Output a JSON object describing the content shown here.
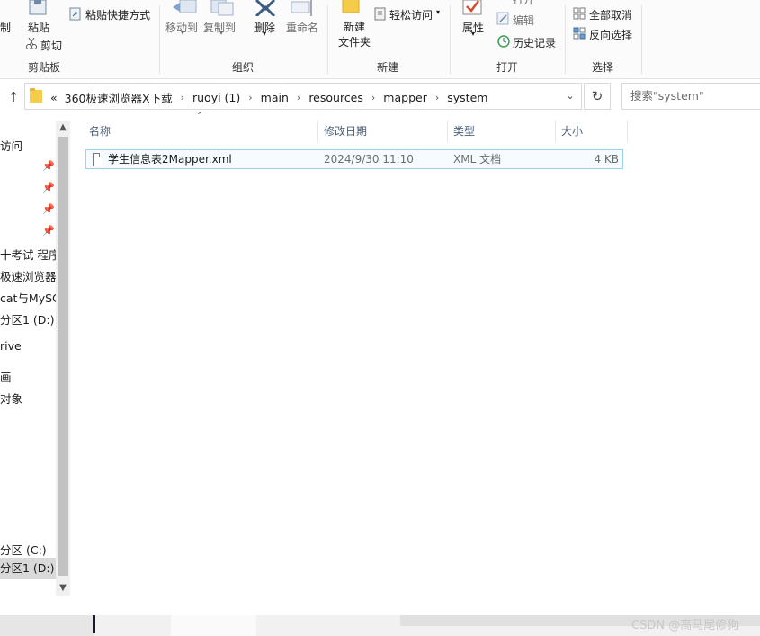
{
  "ribbon": {
    "clipboard": {
      "copy_label": "复制",
      "paste_label": "粘贴",
      "paste_shortcut_label": "粘贴快捷方式",
      "cut_label": "剪切",
      "group_label": "剪贴板"
    },
    "organize": {
      "move_to_label": "移动到",
      "copy_to_label": "复制到",
      "delete_label": "删除",
      "rename_label": "重命名",
      "group_label": "组织"
    },
    "new": {
      "new_folder_label": "新建\n文件夹",
      "easy_access_label": "轻松访问",
      "group_label": "新建"
    },
    "open": {
      "properties_label": "属性",
      "open_label": "打开",
      "edit_label": "编辑",
      "history_label": "历史记录",
      "group_label": "打开"
    },
    "select": {
      "select_all_label": "全部取消",
      "invert_label": "反向选择",
      "group_label": "选择"
    }
  },
  "address": {
    "overflow": "«",
    "crumbs": [
      "360极速浏览器X下载",
      "ruoyi (1)",
      "main",
      "resources",
      "mapper",
      "system"
    ],
    "search_placeholder": "搜索\"system\""
  },
  "nav": {
    "items": [
      {
        "label": "访问",
        "pinned": false
      },
      {
        "label": "",
        "pinned": true
      },
      {
        "label": "",
        "pinned": true
      },
      {
        "label": "",
        "pinned": true
      },
      {
        "label": "",
        "pinned": true
      },
      {
        "label": "十考试 程序",
        "pinned": false
      },
      {
        "label": "极速浏览器X",
        "pinned": false
      },
      {
        "label": "cat与MySC",
        "pinned": false
      },
      {
        "label": "分区1 (D:)",
        "pinned": false
      },
      {
        "label": "rive",
        "pinned": false
      },
      {
        "label": "画",
        "pinned": false
      },
      {
        "label": "对象",
        "pinned": false
      },
      {
        "label": "分区 (C:)",
        "pinned": false
      },
      {
        "label": "分区1 (D:)",
        "pinned": false,
        "selected": true
      }
    ]
  },
  "columns": {
    "name": "名称",
    "date": "修改日期",
    "type": "类型",
    "size": "大小"
  },
  "files": [
    {
      "name": "学生信息表2Mapper.xml",
      "date": "2024/9/30 11:10",
      "type": "XML 文档",
      "size": "4 KB"
    }
  ],
  "watermark": "CSDN @高马尾修狗",
  "colors": {
    "selection_border": "#99d1ee",
    "header_text": "#4c607a",
    "folder_yellow": "#f5cb4a"
  }
}
